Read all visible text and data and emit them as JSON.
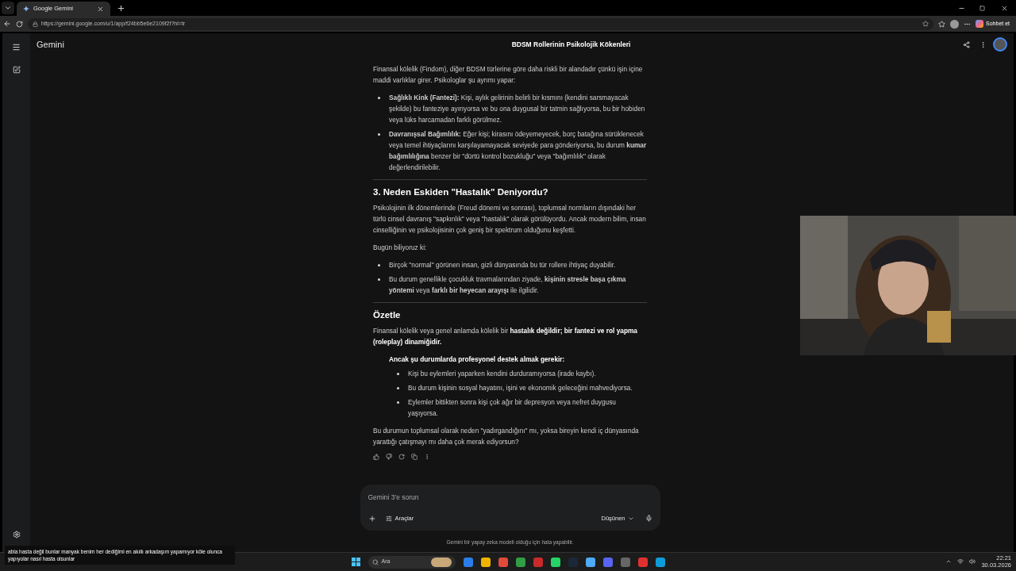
{
  "browser": {
    "tab_title": "Google Gemini",
    "url": "https://gemini.google.com/u/1/app/f24bb5e6e2109f2f?hl=tr",
    "copilot_label": "Sohbet et"
  },
  "app": {
    "brand": "Gemini",
    "chat_title": "BDSM Rollerinin Psikolojik Kökenleri"
  },
  "content": [
    {
      "kind": "paragraph",
      "text": "Finansal kölelik (Findom), diğer BDSM türlerine göre daha riskli bir alandadır çünkü işin içine maddi varlıklar girer. Psikologlar şu ayrımı yapar:"
    },
    {
      "kind": "bullets",
      "items": [
        "**Sağlıklı Kink (Fantezi):** Kişi, aylık gelirinin belirli bir kısmını (kendini sarsmayacak şekilde) bu fanteziye ayırıyorsa ve bu ona duygusal bir tatmin sağlıyorsa, bu bir hobiden veya lüks harcamadan farklı görülmez.",
        "**Davranışsal Bağımlılık:** Eğer kişi; kirasını ödeyemeyecek, borç batağına sürüklenecek veya temel ihtiyaçlarını karşılayamayacak seviyede para gönderiyorsa, bu durum **kumar bağımlılığına** benzer bir \"dürtü kontrol bozukluğu\" veya \"bağımlılık\" olarak değerlendirilebilir."
      ]
    },
    {
      "kind": "divider"
    },
    {
      "kind": "heading",
      "text": "3. Neden Eskiden \"Hastalık\" Deniyordu?"
    },
    {
      "kind": "paragraph",
      "text": "Psikolojinin ilk dönemlerinde (Freud dönemi ve sonrası), toplumsal normların dışındaki her türlü cinsel davranış \"sapkınlık\" veya \"hastalık\" olarak görülüyordu. Ancak modern bilim, insan cinselliğinin ve psikolojisinin çok geniş bir spektrum olduğunu keşfetti."
    },
    {
      "kind": "paragraph",
      "text": "Bugün biliyoruz ki:"
    },
    {
      "kind": "bullets",
      "items": [
        "Birçok \"normal\" görünen insan, gizli dünyasında bu tür rollere ihtiyaç duyabilir.",
        "Bu durum genellikle çocukluk travmalarından ziyade, **kişinin stresle başa çıkma yöntemi** veya **farklı bir heyecan arayışı** ile ilgilidir."
      ]
    },
    {
      "kind": "divider"
    },
    {
      "kind": "heading",
      "text": "Özetle"
    },
    {
      "kind": "paragraph",
      "text": "Finansal kölelik veya genel anlamda kölelik bir **hastalık değildir; bir fantezi ve rol yapma (roleplay) dinamiğidir.**"
    },
    {
      "kind": "quote_heading",
      "text": "Ancak şu durumlarda profesyonel destek almak gerekir:"
    },
    {
      "kind": "quote_bullets",
      "items": [
        "Kişi bu eylemleri yaparken kendini durduramıyorsa (irade kaybı).",
        "Bu durum kişinin sosyal hayatını, işini ve ekonomik geleceğini mahvediyorsa.",
        "Eylemler bittikten sonra kişi çok ağır bir depresyon veya nefret duygusu yaşıyorsa."
      ]
    },
    {
      "kind": "paragraph",
      "text": "Bu durumun toplumsal olarak neden \"yadırgandığını\" mı, yoksa bireyin kendi iç dünyasında yarattığı çatışmayı mı daha çok merak ediyorsun?"
    }
  ],
  "prompt": {
    "placeholder": "Gemini 3'e sorun",
    "tools_label": "Araçlar",
    "mode_label": "Düşünen"
  },
  "disclaimer": "Gemini bir yapay zeka modeli olduğu için hata yapabilir.",
  "stream_chat": {
    "message": "abla hasta değil bunlar manyak benim her dediğimi en akıllı arkadaşım yapamıyor köle olunca yapıyolar nasıl hasta olsunlar"
  },
  "taskbar": {
    "search_placeholder": "Ara",
    "time": "22:21",
    "date": "30.03.2026"
  }
}
